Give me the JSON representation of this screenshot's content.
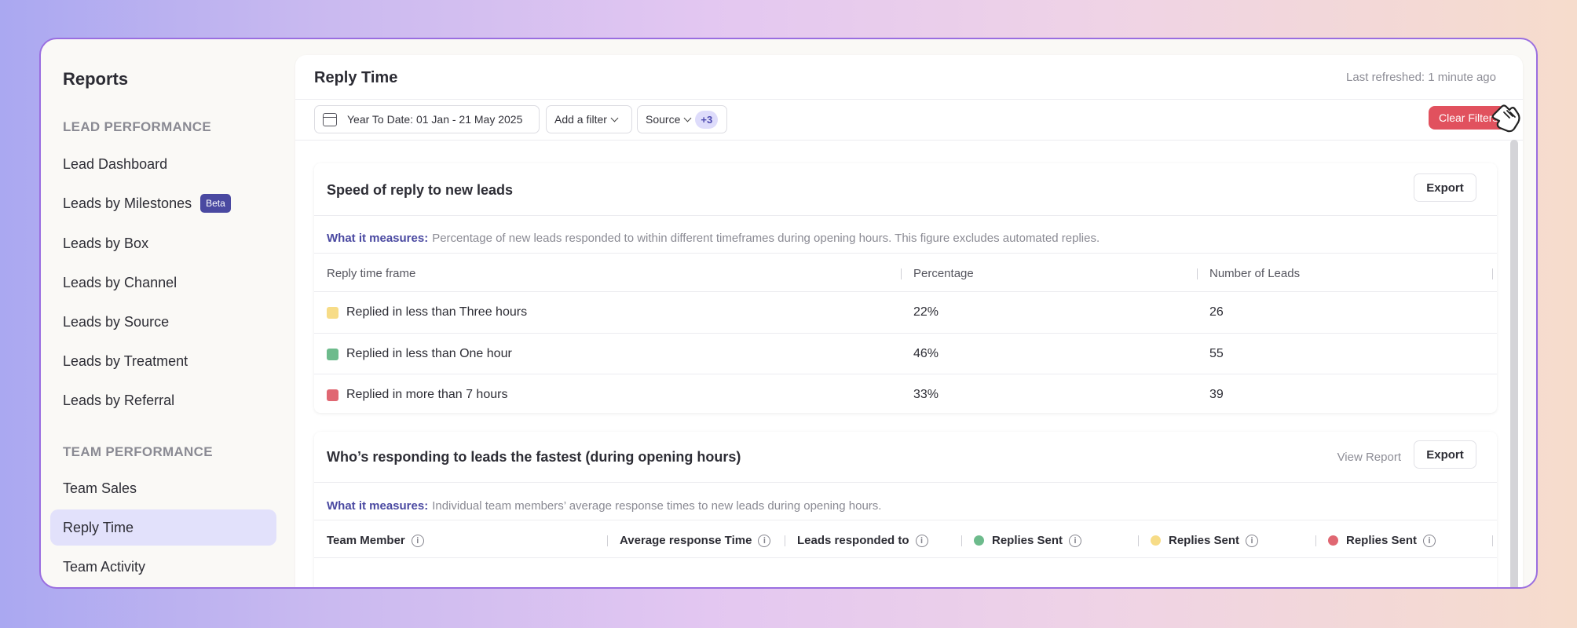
{
  "sidebar": {
    "title": "Reports",
    "sections": [
      {
        "label": "LEAD PERFORMANCE"
      },
      {
        "label": "TEAM PERFORMANCE"
      }
    ],
    "lead_items": [
      {
        "label": "Lead Dashboard"
      },
      {
        "label": "Leads by Milestones",
        "badge": "Beta"
      },
      {
        "label": "Leads by Box"
      },
      {
        "label": "Leads by Channel"
      },
      {
        "label": "Leads by Source"
      },
      {
        "label": "Leads by Treatment"
      },
      {
        "label": "Leads by Referral"
      }
    ],
    "team_items": [
      {
        "label": "Team Sales"
      },
      {
        "label": "Reply Time",
        "active": true
      },
      {
        "label": "Team Activity"
      }
    ]
  },
  "header": {
    "title": "Reply Time",
    "last_refreshed": "Last refreshed: 1 minute ago"
  },
  "filters": {
    "date_range": "Year To Date: 01 Jan - 21 May 2025",
    "add_filter": "Add a filter",
    "source": "Source",
    "source_extra": "+3",
    "clear": "Clear Filters"
  },
  "speed_card": {
    "title": "Speed of reply to new leads",
    "export": "Export",
    "measure_label": "What it measures:",
    "measure_text": "Percentage of new leads responded to within different timeframes during opening hours. This figure excludes automated replies.",
    "columns": [
      "Reply time frame",
      "Percentage",
      "Number of Leads"
    ],
    "rows": [
      {
        "label": "Replied in less than Three hours",
        "percentage": "22%",
        "leads": "26",
        "color": "#f7dc87"
      },
      {
        "label": "Replied in less than One hour",
        "percentage": "46%",
        "leads": "55",
        "color": "#6dbb8c"
      },
      {
        "label": "Replied in more than 7 hours",
        "percentage": "33%",
        "leads": "39",
        "color": "#e06772"
      }
    ]
  },
  "fastest_card": {
    "title": "Who’s responding to leads the fastest (during opening hours)",
    "view_report": "View Report",
    "export": "Export",
    "measure_label": "What it measures:",
    "measure_text": "Individual team members’ average response times to new leads during opening hours.",
    "columns": [
      {
        "label": "Team Member"
      },
      {
        "label": "Average response Time"
      },
      {
        "label": "Leads responded to"
      },
      {
        "label": "Replies Sent",
        "color": "#6dbb8c"
      },
      {
        "label": "Replies Sent",
        "color": "#f7dc87"
      },
      {
        "label": "Replies Sent",
        "color": "#e06772"
      }
    ]
  },
  "colors": {
    "accent": "#4a49a1",
    "active_bg": "#e2e1fb",
    "danger": "#e1515e"
  }
}
